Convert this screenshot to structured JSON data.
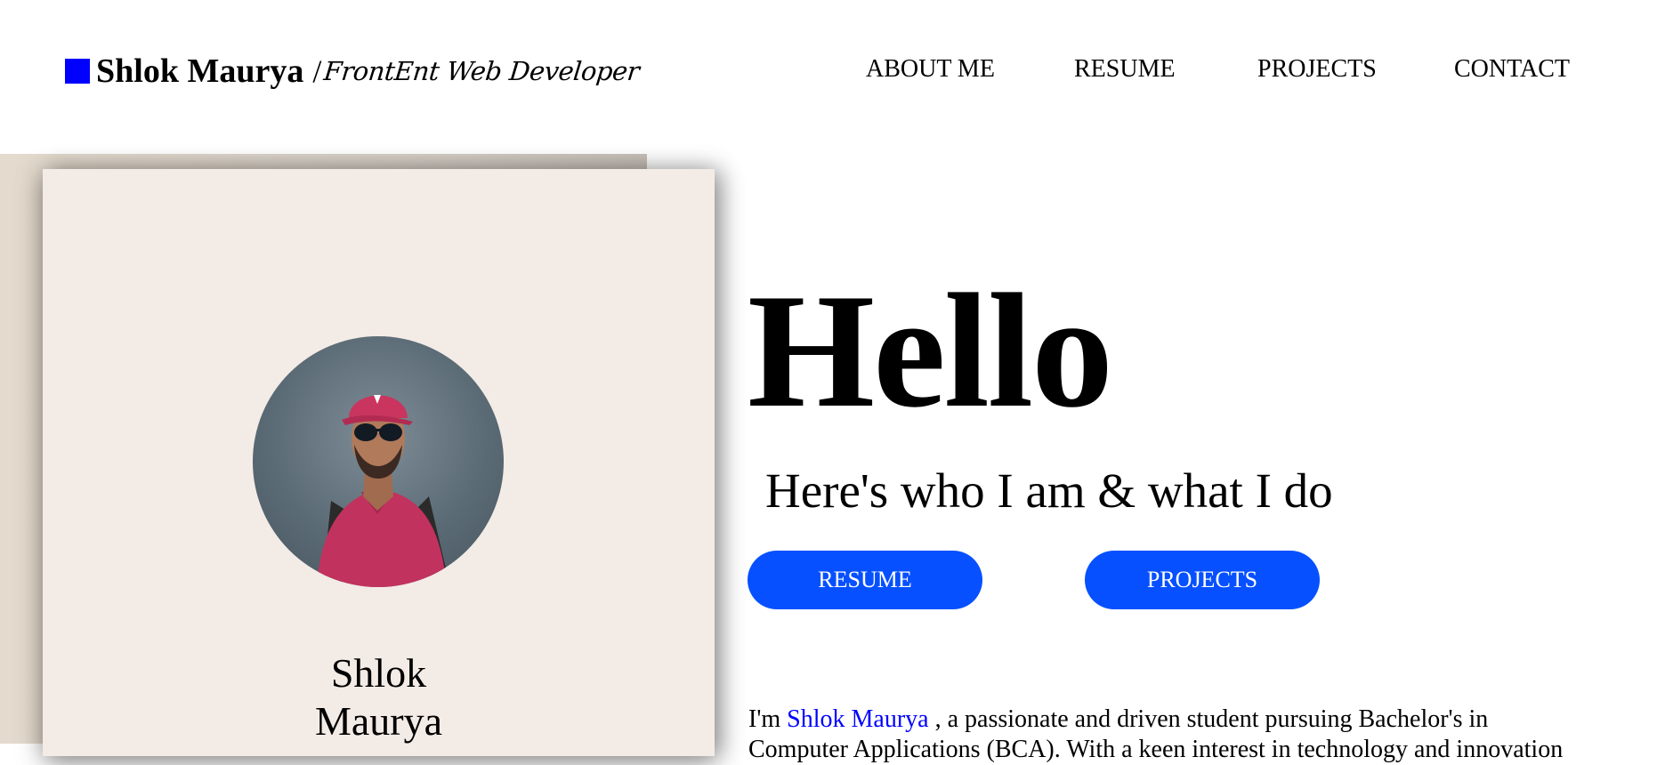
{
  "header": {
    "brand_name": "Shlok Maurya",
    "brand_separator": "/",
    "brand_role": "FrontEnt Web Developer",
    "brand_color": "#0000ff",
    "nav": [
      {
        "label": "ABOUT ME"
      },
      {
        "label": "RESUME"
      },
      {
        "label": "PROJECTS"
      },
      {
        "label": "CONTACT"
      }
    ]
  },
  "profile": {
    "avatar_icon": "profile-photo",
    "name_line1": "Shlok",
    "name_line2": "Maurya"
  },
  "hero": {
    "heading": "Hello",
    "subtitle": "Here's who I am & what I do",
    "buttons": {
      "resume_label": "RESUME",
      "projects_label": "PROJECTS",
      "button_color": "#0650ff"
    }
  },
  "intro": {
    "prefix": "I'm ",
    "name_link": "Shlok Maurya",
    "text": " , a passionate and driven student pursuing Bachelor's in",
    "line2": "Computer Applications (BCA). With a keen interest in technology and innovation"
  }
}
